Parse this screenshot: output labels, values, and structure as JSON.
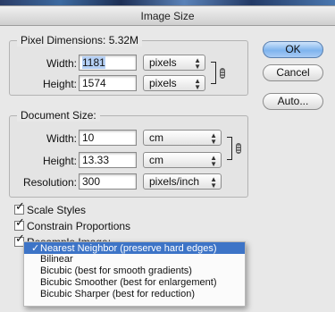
{
  "window": {
    "title": "Image Size"
  },
  "pixel_dimensions": {
    "title": "Pixel Dimensions: 5.32M",
    "width_label": "Width:",
    "width_value": "1181",
    "width_unit": "pixels",
    "height_label": "Height:",
    "height_value": "1574",
    "height_unit": "pixels"
  },
  "document_size": {
    "title": "Document Size:",
    "width_label": "Width:",
    "width_value": "10",
    "width_unit": "cm",
    "height_label": "Height:",
    "height_value": "13.33",
    "height_unit": "cm",
    "resolution_label": "Resolution:",
    "resolution_value": "300",
    "resolution_unit": "pixels/inch"
  },
  "buttons": {
    "ok": "OK",
    "cancel": "Cancel",
    "auto": "Auto..."
  },
  "options": {
    "scale_styles": {
      "label": "Scale Styles",
      "checked": true
    },
    "constrain": {
      "label": "Constrain Proportions",
      "checked": true
    },
    "resample": {
      "label": "Resample Image:",
      "checked": true
    }
  },
  "resample_menu": {
    "items": [
      {
        "label": "Nearest Neighbor (preserve hard edges)",
        "selected": true,
        "check": "✓"
      },
      {
        "label": "Bilinear",
        "selected": false,
        "check": ""
      },
      {
        "label": "Bicubic (best for smooth gradients)",
        "selected": false,
        "check": ""
      },
      {
        "label": "Bicubic Smoother (best for enlargement)",
        "selected": false,
        "check": ""
      },
      {
        "label": "Bicubic Sharper (best for reduction)",
        "selected": false,
        "check": ""
      }
    ]
  },
  "colors": {
    "accent": "#3d74c7",
    "default_button": "#7fb4ee"
  }
}
